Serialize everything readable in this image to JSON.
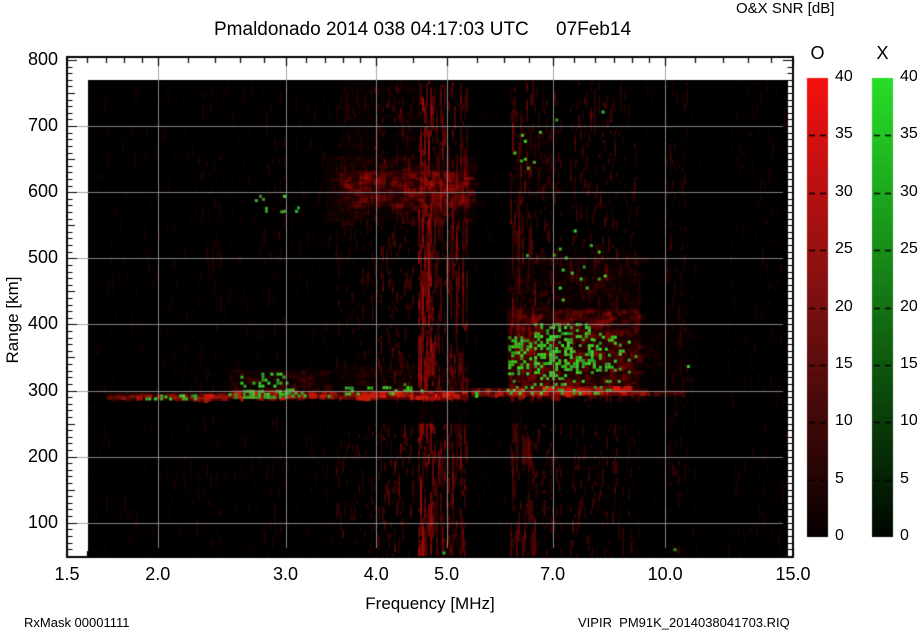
{
  "header": {
    "title": "Pmaldonado 2014 038 04:17:03 UTC",
    "date": "07Feb14"
  },
  "footer": {
    "left": "RxMask 00001111",
    "right": "VIPIR  PM91K_2014038041703.RIQ"
  },
  "colorbar": {
    "title": "O&X SNR [dB]",
    "min": 0,
    "max": 40,
    "tick_values": [
      0,
      5,
      10,
      15,
      20,
      25,
      30,
      35,
      40
    ],
    "tick_labels": [
      "0",
      "5",
      "10",
      "15",
      "20",
      "25",
      "30",
      "35",
      "40"
    ],
    "bars": [
      {
        "name": "O",
        "top_color": "#f61010",
        "mid_color": "#731010",
        "low_color": "#060000"
      },
      {
        "name": "X",
        "top_color": "#28de28",
        "mid_color": "#126e12",
        "low_color": "#000600"
      }
    ]
  },
  "chart_data": {
    "type": "heatmap",
    "title": "Pmaldonado 2014 038 04:17:03 UTC 07Feb14",
    "xlabel": "Frequency [MHz]",
    "ylabel": "Range [km]",
    "x_scale": "log",
    "xlim": [
      1.5,
      15.0
    ],
    "ylim": [
      47,
      805
    ],
    "grid": true,
    "grid_color": "#969696",
    "x_tick_values": [
      1.5,
      2,
      3,
      4,
      5,
      7,
      10,
      15
    ],
    "x_tick_labels": [
      "1.5",
      "2.0",
      "3.0",
      "4.0",
      "5.0",
      "7.0",
      "10.0",
      "15.0"
    ],
    "x_minor_ticks": [
      1.5,
      1.6,
      1.7,
      1.8,
      1.9,
      2.0,
      2.2,
      2.4,
      2.6,
      2.8,
      3.0,
      3.2,
      3.4,
      3.6,
      3.8,
      4.0,
      4.5,
      5.0,
      5.5,
      6.0,
      6.5,
      7.0,
      7.5,
      8.0,
      8.5,
      9.0,
      9.5,
      10,
      11,
      12,
      13,
      14,
      15
    ],
    "y_tick_values": [
      800,
      700,
      600,
      500,
      400,
      300,
      200,
      100
    ],
    "y_tick_labels": [
      "800",
      "700",
      "600",
      "500",
      "400",
      "300",
      "200",
      "100"
    ],
    "grid_x": [
      2,
      3,
      4,
      5,
      7,
      10
    ],
    "grid_y": [
      100,
      200,
      300,
      400,
      500,
      600,
      700
    ],
    "data_extent": {
      "freq_mhz": [
        1.6,
        14.85
      ],
      "range_km": [
        48,
        770
      ]
    },
    "o_mode_color": "#c01010",
    "x_mode_color": "#2f9e22",
    "background": "#000000",
    "features": {
      "noise_bands": [
        [
          1.62,
          3.5,
          0.09
        ],
        [
          2.25,
          2.45,
          0.14
        ],
        [
          2.8,
          3.0,
          0.15
        ],
        [
          3.2,
          3.45,
          0.12
        ],
        [
          3.5,
          4.02,
          0.2
        ],
        [
          4.02,
          4.5,
          0.3
        ],
        [
          4.55,
          4.78,
          0.55
        ],
        [
          4.8,
          5.35,
          0.36
        ],
        [
          5.4,
          6.05,
          0.07
        ],
        [
          6.08,
          6.6,
          0.33
        ],
        [
          6.6,
          7.18,
          0.28
        ],
        [
          7.18,
          7.32,
          0.06
        ],
        [
          7.35,
          8.6,
          0.27
        ],
        [
          8.6,
          9.2,
          0.2
        ],
        [
          9.25,
          9.95,
          0.06
        ],
        [
          10.0,
          10.75,
          0.2
        ],
        [
          10.75,
          11.15,
          0.09
        ],
        [
          11.2,
          12.15,
          0.045
        ],
        [
          12.2,
          14.8,
          0.11
        ]
      ],
      "red_regions": [
        [
          3.4,
          5.5,
          555,
          655,
          0.22
        ],
        [
          3.55,
          5.4,
          578,
          632,
          0.5
        ],
        [
          3.6,
          4.1,
          600,
          768,
          0.14
        ],
        [
          4.2,
          4.55,
          600,
          768,
          0.12
        ],
        [
          6.15,
          7.05,
          590,
          700,
          0.15
        ],
        [
          2.5,
          3.45,
          298,
          332,
          0.3
        ],
        [
          3.55,
          5.35,
          300,
          340,
          0.2
        ],
        [
          6.05,
          9.2,
          293,
          425,
          0.45
        ],
        [
          6.05,
          9.3,
          290,
          505,
          0.16
        ],
        [
          9.3,
          9.95,
          292,
          405,
          0.12
        ],
        [
          10.0,
          10.75,
          288,
          420,
          0.1
        ],
        [
          7.0,
          9.0,
          430,
          520,
          0.1
        ]
      ],
      "trace_segments": [
        [
          1.7,
          2.12,
          285,
          296,
          0.45
        ],
        [
          2.12,
          2.52,
          284,
          296,
          0.6
        ],
        [
          2.52,
          3.12,
          287,
          301,
          0.8
        ],
        [
          3.12,
          3.6,
          287,
          299,
          0.7
        ],
        [
          3.6,
          5.36,
          286,
          300,
          0.95
        ],
        [
          5.4,
          6.6,
          290,
          304,
          0.7
        ],
        [
          6.6,
          9.05,
          292,
          307,
          0.9
        ],
        [
          9.05,
          9.45,
          292,
          303,
          0.45
        ],
        [
          9.45,
          10.7,
          292,
          301,
          0.13
        ]
      ],
      "shadow_regions": [
        [
          3.45,
          9.3,
          250,
          283,
          0.85
        ],
        [
          1.7,
          3.45,
          255,
          282,
          0.5
        ]
      ],
      "green_clusters": [
        [
          1.85,
          2.08,
          286,
          294,
          0.22
        ],
        [
          2.1,
          2.33,
          285,
          294,
          0.33
        ],
        [
          2.48,
          2.62,
          287,
          296,
          0.38
        ],
        [
          2.62,
          3.0,
          288,
          301,
          0.7
        ],
        [
          3.0,
          3.18,
          291,
          303,
          0.45
        ],
        [
          2.6,
          3.02,
          308,
          327,
          0.25
        ],
        [
          3.62,
          3.8,
          295,
          306,
          0.28
        ],
        [
          3.85,
          4.0,
          297,
          306,
          0.22
        ],
        [
          4.08,
          4.45,
          296,
          311,
          0.28
        ],
        [
          5.42,
          5.58,
          289,
          298,
          0.18
        ],
        [
          6.08,
          6.55,
          324,
          382,
          0.45
        ],
        [
          6.6,
          7.26,
          320,
          402,
          0.5
        ],
        [
          7.32,
          7.95,
          328,
          402,
          0.45
        ],
        [
          7.95,
          8.52,
          330,
          392,
          0.28
        ],
        [
          6.05,
          8.62,
          297,
          316,
          0.22
        ],
        [
          8.55,
          8.95,
          330,
          380,
          0.1
        ],
        [
          6.15,
          7.1,
          638,
          702,
          0.05
        ],
        [
          7.0,
          8.25,
          438,
          548,
          0.04
        ],
        [
          2.68,
          3.12,
          562,
          596,
          0.06
        ]
      ],
      "green_specks": [
        [
          2.73,
          588
        ],
        [
          2.96,
          571
        ],
        [
          3.12,
          577
        ],
        [
          3.44,
          292
        ],
        [
          5.5,
          294
        ],
        [
          10.75,
          337
        ],
        [
          8.2,
          722
        ],
        [
          7.08,
          710
        ],
        [
          6.2,
          660
        ],
        [
          6.33,
          648
        ],
        [
          9.1,
          352
        ],
        [
          4.62,
          300
        ],
        [
          7.9,
          520
        ],
        [
          2.05,
          291
        ],
        [
          6.45,
          505
        ],
        [
          4.95,
          55
        ],
        [
          10.3,
          60
        ]
      ]
    }
  }
}
